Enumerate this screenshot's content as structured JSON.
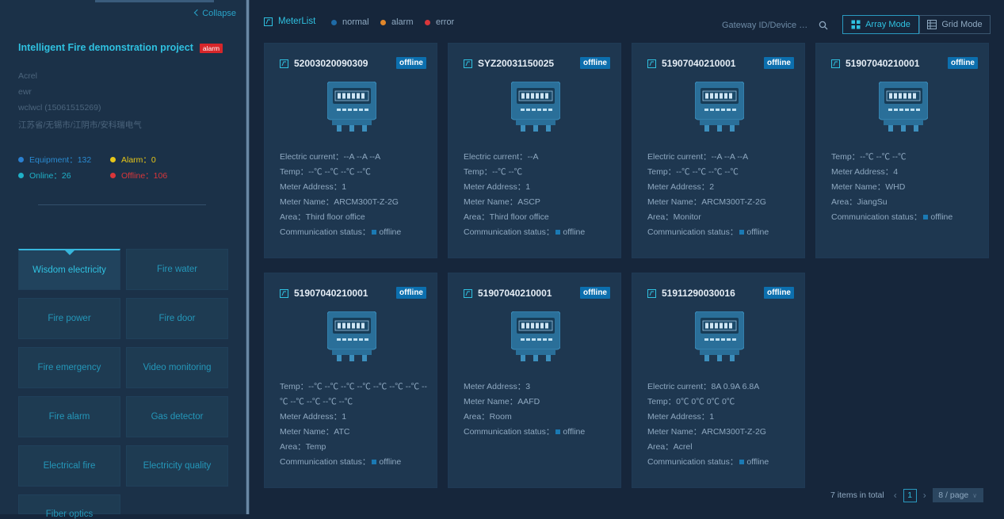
{
  "sidebar": {
    "collapse_label": "Collapse",
    "project_title": "Intelligent Fire demonstration project",
    "project_badge": "alarm",
    "info_lines": [
      "Acrel",
      "ewr",
      "wclwcl (15061515269)",
      "江苏省/无锡市/江阴市/安科瑞电气"
    ],
    "stats": {
      "equipment": "Equipment：132",
      "alarm": "Alarm：0",
      "online": "Online：26",
      "offline": "Offline：106"
    },
    "categories": [
      {
        "label": "Wisdom electricity",
        "active": true
      },
      {
        "label": "Fire water"
      },
      {
        "label": "Fire power"
      },
      {
        "label": "Fire door"
      },
      {
        "label": "Fire emergency"
      },
      {
        "label": "Video monitoring"
      },
      {
        "label": "Fire alarm"
      },
      {
        "label": "Gas detector"
      },
      {
        "label": "Electrical fire"
      },
      {
        "label": "Electricity quality"
      },
      {
        "label": "Fiber optics"
      }
    ]
  },
  "header": {
    "title": "MeterList",
    "legend": [
      {
        "label": "normal",
        "color": "#1e6aa6"
      },
      {
        "label": "alarm",
        "color": "#e0862a"
      },
      {
        "label": "error",
        "color": "#d9363a"
      }
    ],
    "search_placeholder": "Gateway ID/Device M...",
    "array_mode": "Array Mode",
    "grid_mode": "Grid Mode"
  },
  "colors": {
    "accent": "#2fc1e0",
    "badge_offline": "#0c6fae",
    "equipment_dot": "#2a7fd0",
    "alarm_dot": "#e6c619",
    "online_dot": "#1fb1c8",
    "offline_dot": "#d9363a"
  },
  "cards": [
    {
      "id": "52003020090309",
      "status": "offline",
      "rows": [
        "Electric current：--A --A --A",
        "Temp：--℃ --℃ --℃ --℃",
        "Meter Address：1",
        "Meter Name：ARCM300T-Z-2G",
        "Area：Third floor office",
        "Communication status："
      ],
      "comm": "offline"
    },
    {
      "id": "SYZ20031150025",
      "status": "offline",
      "rows": [
        "Electric current：--A",
        "Temp：--℃ --℃",
        "Meter Address：1",
        "Meter Name：ASCP",
        "Area：Third floor office",
        "Communication status："
      ],
      "comm": "offline"
    },
    {
      "id": "51907040210001",
      "status": "offline",
      "rows": [
        "Electric current：--A --A --A",
        "Temp：--℃ --℃ --℃ --℃",
        "Meter Address：2",
        "Meter Name：ARCM300T-Z-2G",
        "Area：Monitor",
        "Communication status："
      ],
      "comm": "offline"
    },
    {
      "id": "51907040210001",
      "status": "offline",
      "rows": [
        "Temp：--℃ --℃ --℃",
        "Meter Address：4",
        "Meter Name：WHD",
        "Area：JiangSu",
        "Communication status："
      ],
      "comm": "offline"
    },
    {
      "id": "51907040210001",
      "status": "offline",
      "rows": [
        "Temp：--℃ --℃ --℃ --℃ --℃ --℃ --℃ --℃ --℃ --℃ --℃ --℃",
        "Meter Address：1",
        "Meter Name：ATC",
        "Area：Temp",
        "Communication status："
      ],
      "comm": "offline"
    },
    {
      "id": "51907040210001",
      "status": "offline",
      "rows": [
        "Meter Address：3",
        "Meter Name：AAFD",
        "Area：Room",
        "Communication status："
      ],
      "comm": "offline"
    },
    {
      "id": "51911290030016",
      "status": "offline",
      "rows": [
        "Electric current：8A 0.9A 6.8A",
        "Temp：0℃ 0℃ 0℃ 0℃",
        "Meter Address：1",
        "Meter Name：ARCM300T-Z-2G",
        "Area：Acrel",
        "Communication status："
      ],
      "comm": "offline"
    }
  ],
  "pagination": {
    "total": "7 items in total",
    "current_page": "1",
    "page_size": "8 / page"
  }
}
